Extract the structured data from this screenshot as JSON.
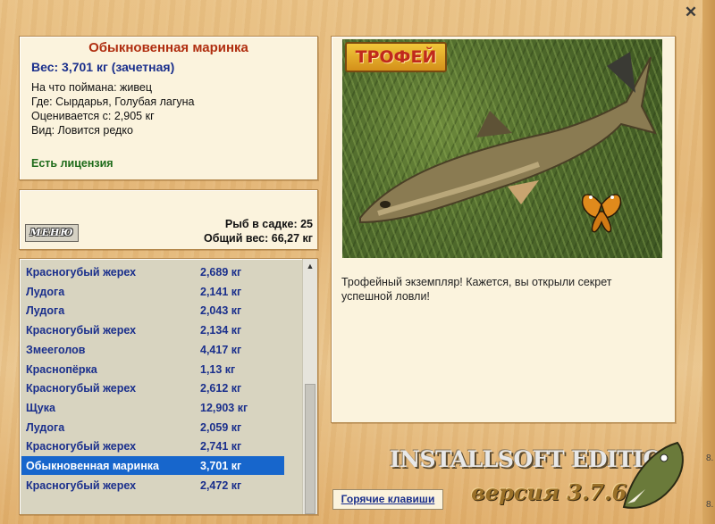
{
  "window": {
    "close_label": "✕"
  },
  "fish_info": {
    "title": "Обыкновенная маринка",
    "weight": "Вес: 3,701 кг (зачетная)",
    "lines": [
      "На что поймана: живец",
      "Где: Сырдарья, Голубая лагуна",
      "Оценивается с: 2,905 кг",
      "Вид: Ловится редко"
    ],
    "license": "Есть лицензия"
  },
  "cage": {
    "menu_label": "МЕНЮ",
    "count": "Рыб в садке: 25",
    "total": "Общий вес: 66,27 кг"
  },
  "catch_list": {
    "rows": [
      {
        "name": "Красногубый жерех",
        "weight": "2,689 кг"
      },
      {
        "name": "Лудога",
        "weight": "2,141 кг"
      },
      {
        "name": "Лудога",
        "weight": "2,043 кг"
      },
      {
        "name": "Красногубый жерех",
        "weight": "2,134 кг"
      },
      {
        "name": "Змееголов",
        "weight": "4,417 кг"
      },
      {
        "name": "Краснопёрка",
        "weight": "1,13 кг"
      },
      {
        "name": "Красногубый жерех",
        "weight": "2,612 кг"
      },
      {
        "name": "Щука",
        "weight": "12,903 кг"
      },
      {
        "name": "Лудога",
        "weight": "2,059 кг"
      },
      {
        "name": "Красногубый жерех",
        "weight": "2,741 кг"
      },
      {
        "name": "Обыкновенная маринка",
        "weight": "3,701 кг",
        "selected": true
      },
      {
        "name": "Красногубый жерех",
        "weight": "2,472 кг"
      }
    ],
    "scroll_position": 1.0
  },
  "photo": {
    "badge": "ТРОФЕЙ",
    "description": "Трофейный экземпляр! Кажется, вы открыли секрет успешной ловли!"
  },
  "footer": {
    "hotkeys": "Горячие клавиши",
    "brand": "INSTALLSOFT EDITION",
    "version": "версия 3.7.6"
  },
  "side_marks": [
    "8.",
    "8."
  ],
  "colors": {
    "selected_row": "#1766cc",
    "fish_name": "#b02e10",
    "list_text": "#1a2f8c",
    "license": "#1e6b1a"
  }
}
